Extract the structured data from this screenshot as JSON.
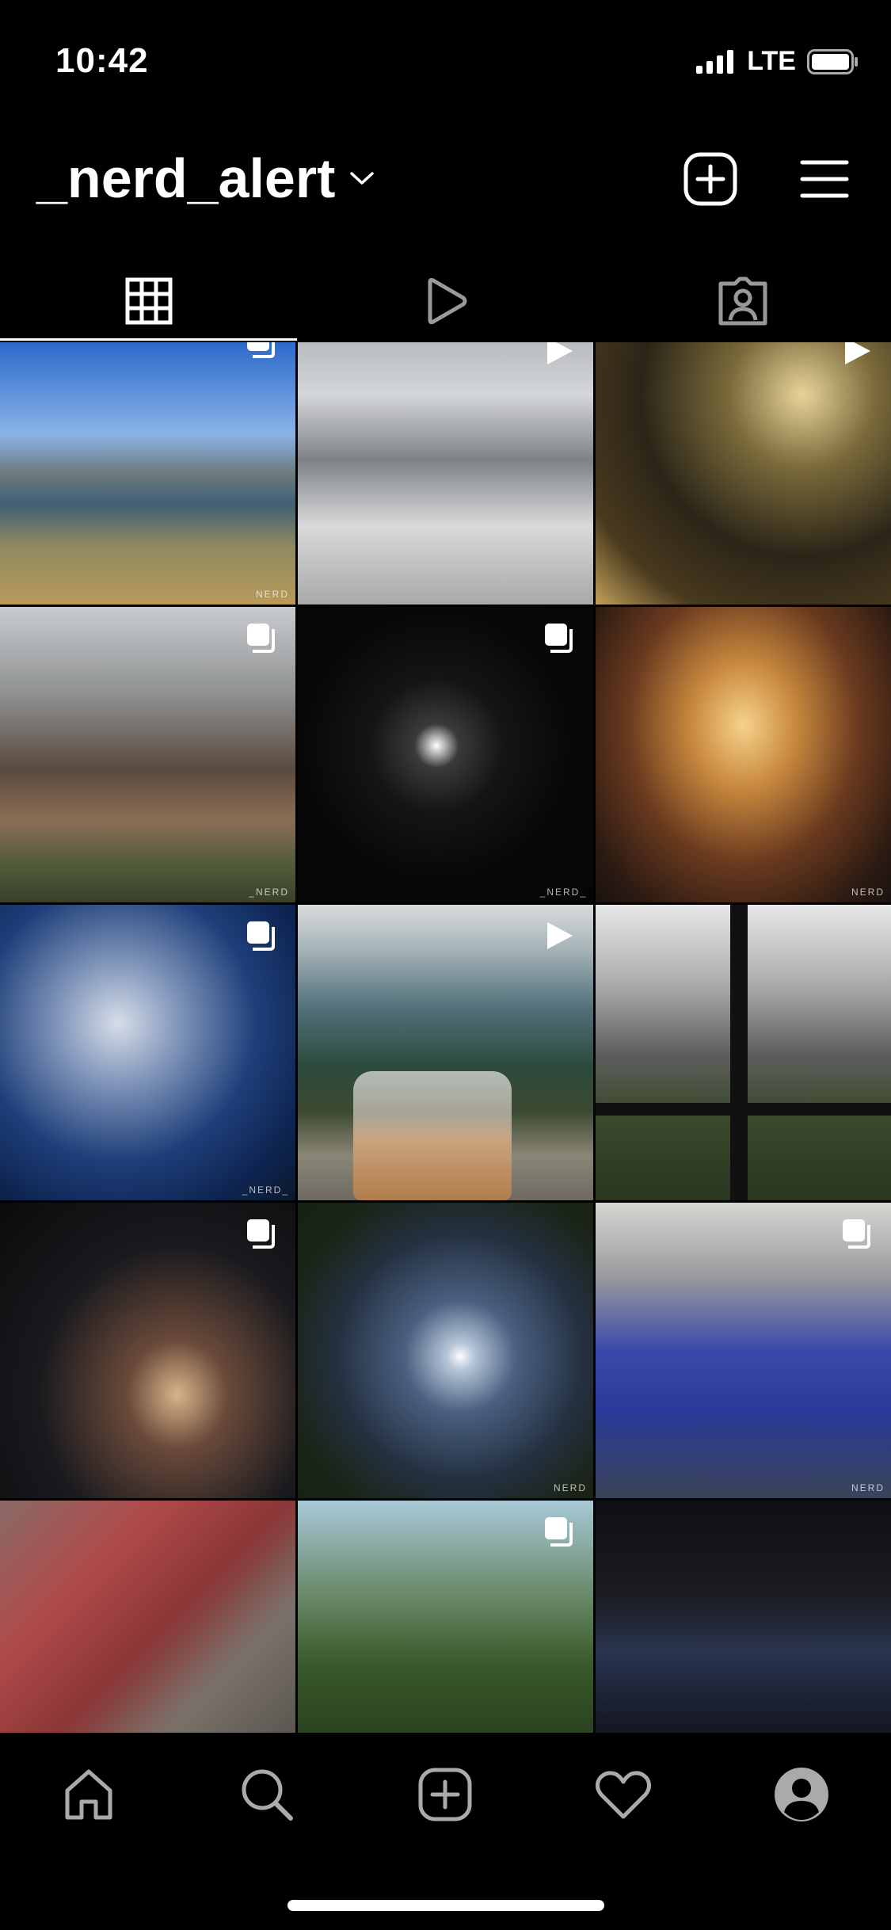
{
  "status_bar": {
    "time": "10:42",
    "network": "LTE"
  },
  "header": {
    "username": "_nerd_alert"
  },
  "tabs": [
    {
      "name": "grid-tab",
      "icon": "grid-icon",
      "active": true
    },
    {
      "name": "reels-tab",
      "icon": "play-icon",
      "active": false
    },
    {
      "name": "tagged-tab",
      "icon": "tagged-person-icon",
      "active": false
    }
  ],
  "posts": [
    {
      "subject": "river valley town",
      "badge": "multiple",
      "watermark": "NERD"
    },
    {
      "subject": "snowy street",
      "badge": "reel",
      "watermark": ""
    },
    {
      "subject": "ornament lights",
      "badge": "reel",
      "watermark": ""
    },
    {
      "subject": "old house",
      "badge": "multiple",
      "watermark": "_NERD"
    },
    {
      "subject": "night moon clouds",
      "badge": "multiple",
      "watermark": "_NERD_"
    },
    {
      "subject": "lit pavilion",
      "badge": "none",
      "watermark": "NERD"
    },
    {
      "subject": "blue sky clouds",
      "badge": "multiple",
      "watermark": "_NERD_"
    },
    {
      "subject": "tea cup mountains",
      "badge": "reel",
      "watermark": ""
    },
    {
      "subject": "window pole field",
      "badge": "none",
      "watermark": ""
    },
    {
      "subject": "city lights at night",
      "badge": "multiple",
      "watermark": ""
    },
    {
      "subject": "moon over trees",
      "badge": "none",
      "watermark": "NERD"
    },
    {
      "subject": "rain drops",
      "badge": "multiple",
      "watermark": "NERD"
    },
    {
      "subject": "red car",
      "badge": "none",
      "watermark": ""
    },
    {
      "subject": "forest branch",
      "badge": "multiple",
      "watermark": ""
    },
    {
      "subject": "car at night",
      "badge": "none",
      "watermark": ""
    }
  ],
  "bottom_nav": [
    {
      "name": "home",
      "icon": "home-icon"
    },
    {
      "name": "search",
      "icon": "search-icon"
    },
    {
      "name": "create",
      "icon": "add-post-icon"
    },
    {
      "name": "activity",
      "icon": "heart-icon"
    },
    {
      "name": "profile",
      "icon": "avatar-icon"
    }
  ]
}
